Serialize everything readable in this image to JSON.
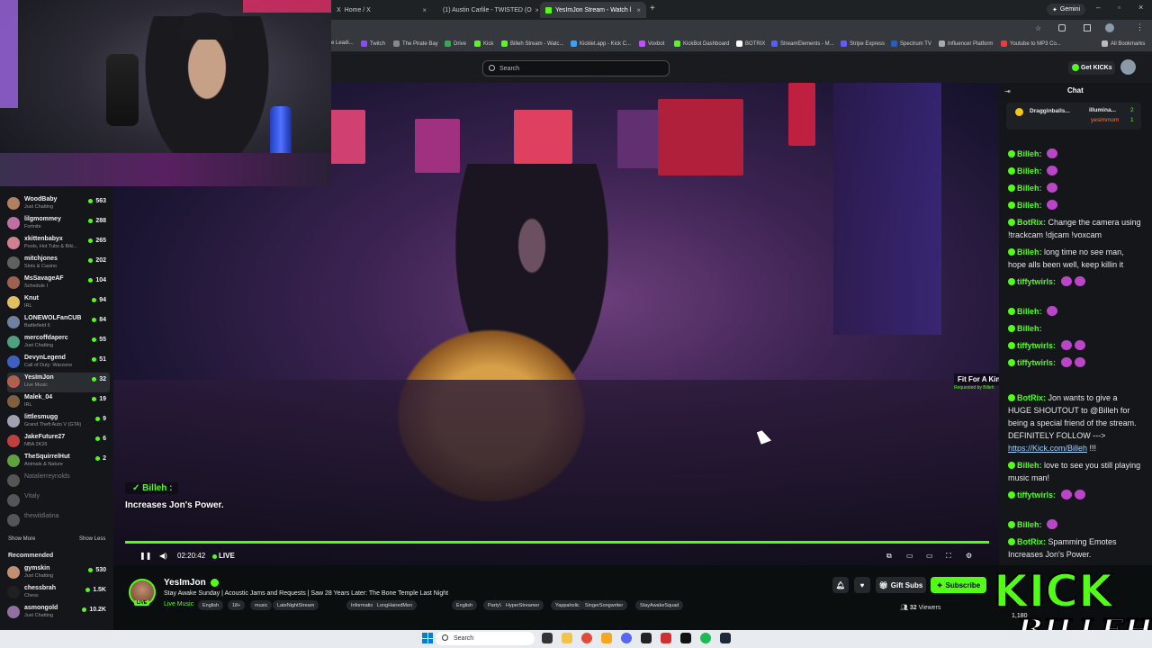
{
  "browser": {
    "tabs": [
      {
        "label": "Home / X"
      },
      {
        "label": "(1) Austin Carlile - TWISTED (O"
      },
      {
        "label": "YesImJon Stream - Watch l"
      }
    ],
    "gemini_label": "Gemini",
    "bookmarks": [
      "e Leadi...",
      "Twitch",
      "The Pirate Bay",
      "Drive",
      "Kick",
      "Billeh Stream - Watc...",
      "Kicklet.app - Kick C...",
      "Voxbot",
      "KickBot Dashboard",
      "BOTRIX",
      "StreamElements - M...",
      "Stripe Express",
      "Spectrum TV",
      "Influencer Platform",
      "Youtube to MP3 Co...",
      "All Bookmarks"
    ]
  },
  "header": {
    "search_placeholder": "Search",
    "get_kicks_label": "Get KICKs"
  },
  "sidebar": {
    "following": [
      {
        "name": "WoodBaby",
        "category": "Just Chatting",
        "viewers": "563",
        "color": "#b08060"
      },
      {
        "name": "lilgmommey",
        "category": "Fortnite",
        "viewers": "288",
        "color": "#c070a0"
      },
      {
        "name": "xkittenbabyx",
        "category": "Pools, Hot Tubs & Biki...",
        "viewers": "265",
        "color": "#d08090"
      },
      {
        "name": "mitchjones",
        "category": "Slots & Casino",
        "viewers": "202",
        "color": "#606060"
      },
      {
        "name": "MsSavageAF",
        "category": "Schedule I",
        "viewers": "104",
        "color": "#a06050"
      },
      {
        "name": "Knut",
        "category": "IRL",
        "viewers": "94",
        "color": "#e0c060"
      },
      {
        "name": "LONEWOLFanCUB",
        "category": "Battlefield 6",
        "viewers": "84",
        "color": "#7080a0"
      },
      {
        "name": "mercoffdaperc",
        "category": "Just Chatting",
        "viewers": "55",
        "color": "#50a080"
      },
      {
        "name": "DevynLegend",
        "category": "Call of Duty: Warzone",
        "viewers": "51",
        "color": "#4060c0"
      },
      {
        "name": "YesImJon",
        "category": "Live Music",
        "viewers": "32",
        "color": "#b06050"
      },
      {
        "name": "Malek_04",
        "category": "IRL",
        "viewers": "19",
        "color": "#806040"
      },
      {
        "name": "littlesmugg",
        "category": "Grand Theft Auto V (GTA)",
        "viewers": "9",
        "color": "#a0a0b0"
      },
      {
        "name": "JakeFuture27",
        "category": "NBA 2K26",
        "viewers": "6",
        "color": "#c04040"
      },
      {
        "name": "TheSquirrelHut",
        "category": "Animals & Nature",
        "viewers": "2",
        "color": "#60a040"
      },
      {
        "name": "Natalierreynolds",
        "category": "",
        "viewers": "",
        "color": "#555"
      },
      {
        "name": "Vitaly",
        "category": "",
        "viewers": "",
        "color": "#555"
      },
      {
        "name": "thewildlatina",
        "category": "",
        "viewers": "",
        "color": "#555"
      }
    ],
    "show_more": "Show More",
    "show_less": "Show Less",
    "recommended_title": "Recommended",
    "recommended": [
      {
        "name": "gymskin",
        "category": "Just Chatting",
        "viewers": "530",
        "color": "#c09070"
      },
      {
        "name": "chessbrah",
        "category": "Chess",
        "viewers": "1.5K",
        "color": "#202020"
      },
      {
        "name": "asmongold",
        "category": "Just Chatting",
        "viewers": "10.2K",
        "color": "#9070a0"
      }
    ]
  },
  "video": {
    "caption_user": "Billeh :",
    "caption_text": "Increases Jon's Power.",
    "now_playing": "Fit For A King - Between Us (Official Visualizer)",
    "now_playing_req": "Requested by Billeh",
    "time": "02:20:42",
    "live_label": "LIVE"
  },
  "chat": {
    "title": "Chat",
    "pinned": {
      "user1": "Dragginballs...",
      "user2": "illumina...",
      "user3": "yesimmom",
      "count1": "2",
      "count2": "1"
    },
    "messages": [
      {
        "user": "Billeh:",
        "text": "",
        "emotes": 1,
        "color": "#53fc18"
      },
      {
        "user": "Billeh:",
        "text": "",
        "emotes": 1,
        "color": "#53fc18"
      },
      {
        "user": "Billeh:",
        "text": "",
        "emotes": 1,
        "color": "#53fc18"
      },
      {
        "user": "Billeh:",
        "text": "",
        "emotes": 1,
        "color": "#53fc18"
      },
      {
        "user": "BotRix:",
        "text": "Change the camera using !trackcam !djcam !voxcam",
        "emotes": 0,
        "color": "#53fc18"
      },
      {
        "user": "Billeh:",
        "text": "long time no see man, hope alls been well, keep killin it",
        "emotes": 0,
        "color": "#53fc18"
      },
      {
        "user": "tiffytwirls:",
        "text": "",
        "emotes": 2,
        "color": "#53fc18"
      },
      {
        "user": "Billeh:",
        "text": "",
        "emotes": 1,
        "color": "#53fc18"
      },
      {
        "user": "Billeh:",
        "text": "",
        "emotes": 0,
        "color": "#53fc18"
      },
      {
        "user": "tiffytwirls:",
        "text": "",
        "emotes": 2,
        "color": "#53fc18"
      },
      {
        "user": "tiffytwirls:",
        "text": "",
        "emotes": 2,
        "color": "#53fc18"
      },
      {
        "user": "BotRix:",
        "text": "Jon wants to give a HUGE SHOUTOUT to @Billeh for being a special friend of the stream. DEFINITELY FOLLOW ---> ",
        "link": "https://Kick.com/Billeh",
        "suffix": " !!!",
        "emotes": 0,
        "color": "#53fc18"
      },
      {
        "user": "Billeh:",
        "text": "love to see you still playing music man!",
        "emotes": 0,
        "color": "#53fc18"
      },
      {
        "user": "tiffytwirls:",
        "text": "",
        "emotes": 2,
        "color": "#53fc18"
      },
      {
        "user": "Billeh:",
        "text": "",
        "emotes": 1,
        "color": "#53fc18"
      },
      {
        "user": "BotRix:",
        "text": "Spamming Emotes Increases Jon's Power.",
        "emotes": 0,
        "color": "#53fc18"
      }
    ]
  },
  "stream": {
    "streamer": "YesImJon",
    "live_badge": "LIVE",
    "title": "Stay Awake Sunday | Acoustic Jams and Requests | Saw 28 Years Later: The Bone Temple Last Night",
    "category": "Live Music",
    "tags": [
      "English",
      "18+",
      "music",
      "LateNightStream",
      "Informational",
      "LongHairedMen",
      "English",
      "PartyVibes",
      "HyperStreamer",
      "Yappaholic",
      "SingerSongwriter",
      "StayAwakeSquad"
    ],
    "gift_subs": "Gift Subs",
    "subscribe": "Subscribe",
    "viewers": "32",
    "viewers_label": "Viewers",
    "followers": "1,180"
  },
  "overlay_logo": {
    "kick": "KICK",
    "name": "BILLEH"
  },
  "taskbar": {
    "search_label": "Search"
  },
  "colors": {
    "accent": "#53fc18",
    "bg": "#0b0e0f",
    "panel": "#14161a"
  }
}
